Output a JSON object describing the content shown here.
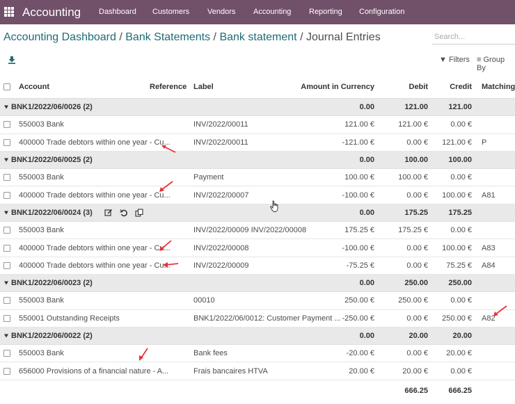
{
  "topbar": {
    "app_name": "Accounting",
    "menu": [
      "Dashboard",
      "Customers",
      "Vendors",
      "Accounting",
      "Reporting",
      "Configuration"
    ],
    "bg_color": "#71506a"
  },
  "breadcrumb": {
    "items": [
      "Accounting Dashboard",
      "Bank Statements",
      "Bank statement"
    ],
    "current": "Journal Entries",
    "separator": "/"
  },
  "search": {
    "placeholder": "Search..."
  },
  "toolbar": {
    "download_icon": "download-icon",
    "filters_label": "Filters",
    "groupby_label": "Group By"
  },
  "table": {
    "headers": {
      "account": "Account",
      "reference": "Reference",
      "label": "Label",
      "amount_currency": "Amount in Currency",
      "debit": "Debit",
      "credit": "Credit",
      "matching": "Matching"
    },
    "groups": [
      {
        "name": "BNK1/2022/06/0026 (2)",
        "amount": "0.00",
        "debit": "121.00",
        "credit": "121.00",
        "rows": [
          {
            "account": "550003 Bank",
            "label": "INV/2022/00011",
            "amount": "121.00 €",
            "debit": "121.00 €",
            "credit": "0.00 €",
            "matching": ""
          },
          {
            "account": "400000 Trade debtors within one year - Cu...",
            "label": "INV/2022/00011",
            "amount": "-121.00 €",
            "debit": "0.00 €",
            "credit": "121.00 €",
            "matching": "P"
          }
        ]
      },
      {
        "name": "BNK1/2022/06/0025 (2)",
        "amount": "0.00",
        "debit": "100.00",
        "credit": "100.00",
        "rows": [
          {
            "account": "550003 Bank",
            "label": "Payment",
            "amount": "100.00 €",
            "debit": "100.00 €",
            "credit": "0.00 €",
            "matching": ""
          },
          {
            "account": "400000 Trade debtors within one year - Cu...",
            "label": "INV/2022/00007",
            "amount": "-100.00 €",
            "debit": "0.00 €",
            "credit": "100.00 €",
            "matching": "A81"
          }
        ]
      },
      {
        "name": "BNK1/2022/06/0024 (3)",
        "amount": "0.00",
        "debit": "175.25",
        "credit": "175.25",
        "rows": [
          {
            "account": "550003 Bank",
            "label": "INV/2022/00009 INV/2022/00008",
            "amount": "175.25 €",
            "debit": "175.25 €",
            "credit": "0.00 €",
            "matching": ""
          },
          {
            "account": "400000 Trade debtors within one year - Cu...",
            "label": "INV/2022/00008",
            "amount": "-100.00 €",
            "debit": "0.00 €",
            "credit": "100.00 €",
            "matching": "A83"
          },
          {
            "account": "400000 Trade debtors within one year - Cu...",
            "label": "INV/2022/00009",
            "amount": "-75.25 €",
            "debit": "0.00 €",
            "credit": "75.25 €",
            "matching": "A84"
          }
        ]
      },
      {
        "name": "BNK1/2022/06/0023 (2)",
        "amount": "0.00",
        "debit": "250.00",
        "credit": "250.00",
        "rows": [
          {
            "account": "550003 Bank",
            "label": "00010",
            "amount": "250.00 €",
            "debit": "250.00 €",
            "credit": "0.00 €",
            "matching": ""
          },
          {
            "account": "550001 Outstanding Receipts",
            "label": "BNK1/2022/06/0012: Customer Payment ...",
            "amount": "-250.00 €",
            "debit": "0.00 €",
            "credit": "250.00 €",
            "matching": "A82"
          }
        ]
      },
      {
        "name": "BNK1/2022/06/0022 (2)",
        "amount": "0.00",
        "debit": "20.00",
        "credit": "20.00",
        "rows": [
          {
            "account": "550003 Bank",
            "label": "Bank fees",
            "amount": "-20.00 €",
            "debit": "0.00 €",
            "credit": "20.00 €",
            "matching": ""
          },
          {
            "account": "656000 Provisions of a financial nature - A...",
            "label": "Frais bancaires HTVA",
            "amount": "20.00 €",
            "debit": "20.00 €",
            "credit": "0.00 €",
            "matching": ""
          }
        ]
      }
    ],
    "totals": {
      "debit": "666.25",
      "credit": "666.25"
    }
  },
  "colors": {
    "annotation_arrow": "#e8303a",
    "link": "#1f6b75",
    "group_bg": "#e9e9e9"
  }
}
